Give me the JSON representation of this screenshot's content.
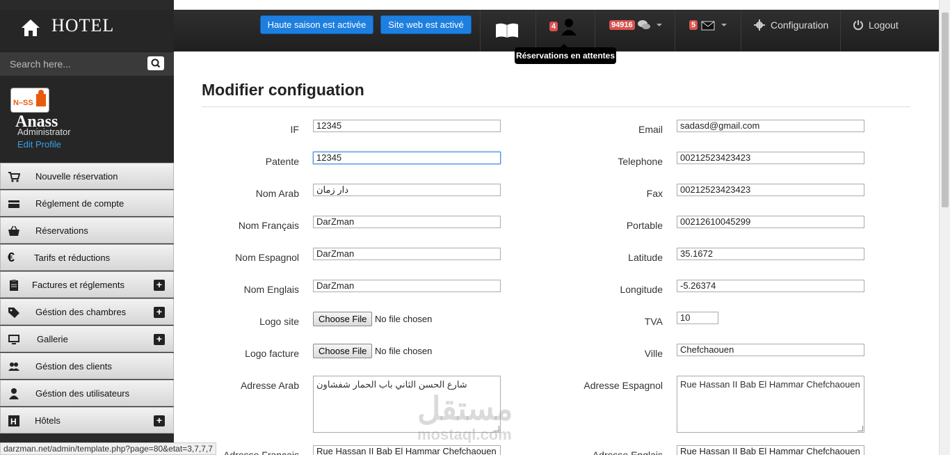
{
  "brand": {
    "title": "HOTEL"
  },
  "search": {
    "placeholder": "Search here..."
  },
  "profile": {
    "name": "Anass",
    "role": "Administrator",
    "edit_label": "Edit Profile"
  },
  "sidebar": {
    "items": [
      {
        "label": "Nouvelle réservation",
        "icon": "cart-icon",
        "expandable": false
      },
      {
        "label": "Réglement de compte",
        "icon": "credit-card-icon",
        "expandable": false
      },
      {
        "label": "Réservations",
        "icon": "basket-icon",
        "expandable": false
      },
      {
        "label": "Tarifs et réductions",
        "icon": "euro-icon",
        "expandable": false
      },
      {
        "label": "Factures et réglements",
        "icon": "clipboard-icon",
        "expandable": true
      },
      {
        "label": "Géstion des chambres",
        "icon": "tag-icon",
        "expandable": true
      },
      {
        "label": "Gallerie",
        "icon": "monitor-icon",
        "expandable": true
      },
      {
        "label": "Géstion des clients",
        "icon": "users-icon",
        "expandable": false
      },
      {
        "label": "Géstion des utilisateurs",
        "icon": "user-icon",
        "expandable": false
      },
      {
        "label": "Hôtels",
        "icon": "hotel-icon",
        "expandable": true
      }
    ]
  },
  "topbar": {
    "season_button": "Haute saison est activée",
    "website_button": "Site web est activé",
    "reservations_badge": "4",
    "messages_badge": "94916",
    "mail_badge": "5",
    "config_label": "Configuration",
    "logout_label": "Logout",
    "tooltip": "Réservations en attentes"
  },
  "page": {
    "title": "Modifier configuation",
    "left_fields": [
      {
        "label": "IF",
        "value": "12345"
      },
      {
        "label": "Patente",
        "value": "12345"
      },
      {
        "label": "Nom Arab",
        "value": "دار زمان"
      },
      {
        "label": "Nom Français",
        "value": "DarZman"
      },
      {
        "label": "Nom Espagnol",
        "value": "DarZman"
      },
      {
        "label": "Nom Englais",
        "value": "DarZman"
      }
    ],
    "right_fields": [
      {
        "label": "Email",
        "value": "sadasd@gmail.com"
      },
      {
        "label": "Telephone",
        "value": "00212523423423"
      },
      {
        "label": "Fax",
        "value": "00212523423423"
      },
      {
        "label": "Portable",
        "value": "00212610045299"
      },
      {
        "label": "Latitude",
        "value": "35.1672"
      },
      {
        "label": "Longitude",
        "value": "-5.26374"
      }
    ],
    "logo_site_label": "Logo site",
    "logo_facture_label": "Logo facture",
    "choose_file": "Choose File",
    "no_file": "No file chosen",
    "tva_label": "TVA",
    "tva_value": "10",
    "ville_label": "Ville",
    "ville_value": "Chefchaouen",
    "adresse_arab_label": "Adresse Arab",
    "adresse_arab_value": "شارع الحسن الثاني باب الحمار  شفشاون",
    "adresse_espagnol_label": "Adresse Espagnol",
    "adresse_espagnol_value": "Rue Hassan II Bab El Hammar Chefchaouen",
    "adresse_francais_label": "Adresse Français",
    "adresse_francais_value": "Rue Hassan II Bab El Hammar Chefchaouen",
    "adresse_englais_label": "Adresse Englais",
    "adresse_englais_value": "Rue Hassan II Bab El Hammar Chefchaouen"
  },
  "statusbar": {
    "url": "darzman.net/admin/template.php?page=80&etat=3,7,7,7"
  },
  "watermark": {
    "arabic": "مستقل",
    "latin": "mostaql.com"
  },
  "colors": {
    "accent": "#1d7fe0",
    "badge": "#d9534f",
    "link": "#3aa0e8"
  }
}
